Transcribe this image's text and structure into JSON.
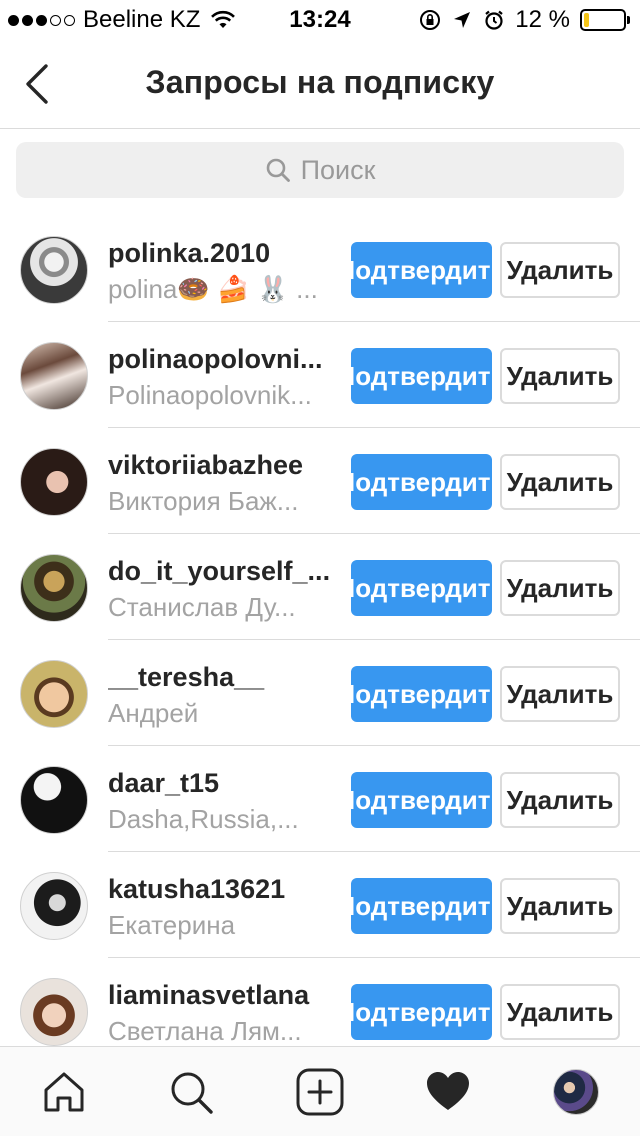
{
  "status_bar": {
    "carrier": "Beeline KZ",
    "time": "13:24",
    "battery": "12 %",
    "battery_level": 0.12,
    "battery_color": "#f5c518"
  },
  "header": {
    "back_icon": "chevron-left-icon",
    "title": "Запросы на подписку"
  },
  "search": {
    "icon": "search-icon",
    "placeholder": "Поиск"
  },
  "colors": {
    "accent": "#3897f0",
    "secondary_text": "#a3a3a3",
    "divider": "#dbdbdb"
  },
  "requests": [
    {
      "username": "polinka.2010",
      "fullname": "polina🍩 🍰 🐰 ...",
      "confirm_label": "Подтвердить",
      "delete_label": "Удалить"
    },
    {
      "username": "polinaopolovni...",
      "fullname": "Polinaopolovnik...",
      "confirm_label": "Подтвердить",
      "delete_label": "Удалить"
    },
    {
      "username": "viktoriiabazhee",
      "fullname": "Виктория Баж...",
      "confirm_label": "Подтвердить",
      "delete_label": "Удалить"
    },
    {
      "username": "do_it_yourself_...",
      "fullname": "Станислав Ду...",
      "confirm_label": "Подтвердить",
      "delete_label": "Удалить"
    },
    {
      "username": "__teresha__",
      "fullname": "Андрей",
      "confirm_label": "Подтвердить",
      "delete_label": "Удалить"
    },
    {
      "username": "daar_t15",
      "fullname": "Dasha,Russia,...",
      "confirm_label": "Подтвердить",
      "delete_label": "Удалить"
    },
    {
      "username": "katusha13621",
      "fullname": "Екатерина",
      "confirm_label": "Подтвердить",
      "delete_label": "Удалить"
    },
    {
      "username": "liaminasvetlana",
      "fullname": "Светлана Лям...",
      "confirm_label": "Подтвердить",
      "delete_label": "Удалить"
    }
  ],
  "tab_bar": {
    "items": [
      "home-icon",
      "search-icon",
      "add-post-icon",
      "heart-icon",
      "profile-avatar"
    ],
    "active": "heart-icon"
  }
}
